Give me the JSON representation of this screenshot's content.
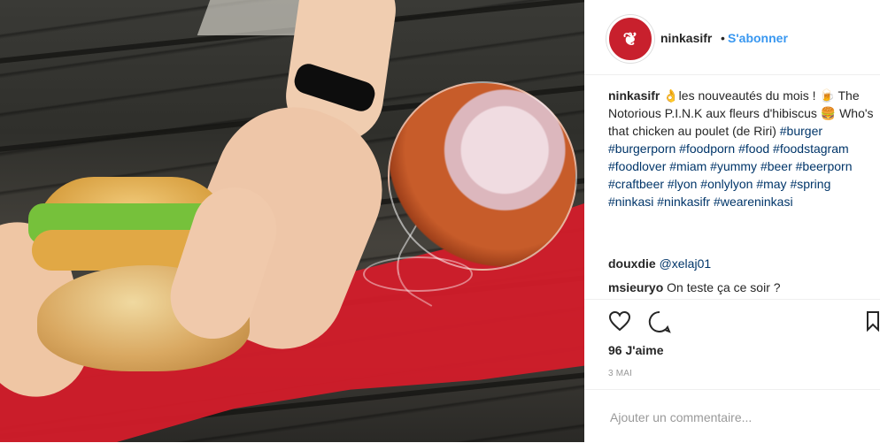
{
  "header": {
    "username": "ninkasifr",
    "separator": "•",
    "follow_label": "S'abonner",
    "avatar_icon": "ninkasi-logo-icon"
  },
  "caption": {
    "username": "ninkasifr",
    "text": "👌les nouveautés du mois ! 🍺 The Notorious P.I.N.K aux fleurs d'hibiscus 🍔 Who's that chicken au poulet (de Riri)",
    "hashtags": "#burger #burgerporn #foodporn #food #foodstagram #foodlover #miam #yummy #beer #beerporn #craftbeer #lyon #onlylyon #may #spring #ninkasi #ninkasifr #weareninkasi"
  },
  "comments": [
    {
      "username": "douxdie",
      "mention": "@xelaj01",
      "text": ""
    },
    {
      "username": "msieuryo",
      "mention": "",
      "text": "On teste ça ce soir ?"
    }
  ],
  "actions": {
    "like_icon": "heart-icon",
    "comment_icon": "speech-bubble-icon",
    "save_icon": "bookmark-icon"
  },
  "likes_label": "96 J'aime",
  "date_label": "3 MAI",
  "comment_placeholder": "Ajouter un commentaire...",
  "colors": {
    "link": "#3897f0",
    "hashtag": "#003569",
    "avatar": "#c8202d"
  }
}
